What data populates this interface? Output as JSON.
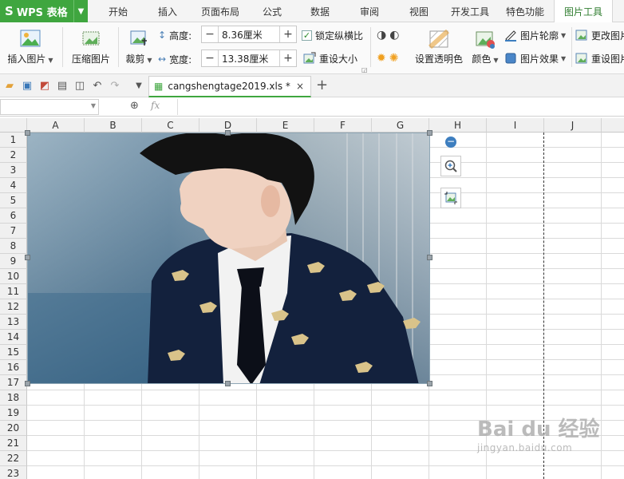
{
  "app": {
    "name": "WPS 表格",
    "logo": "S"
  },
  "menu": {
    "tabs": [
      {
        "label": "开始"
      },
      {
        "label": "插入"
      },
      {
        "label": "页面布局"
      },
      {
        "label": "公式"
      },
      {
        "label": "数据"
      },
      {
        "label": "审阅"
      },
      {
        "label": "视图"
      },
      {
        "label": "开发工具"
      },
      {
        "label": "特色功能"
      },
      {
        "label": "图片工具"
      }
    ],
    "active": "图片工具"
  },
  "ribbon": {
    "insert_picture": "插入图片",
    "compress_picture": "压缩图片",
    "crop": "裁剪",
    "height_label": "高度:",
    "height_value": "8.36厘米",
    "width_label": "宽度:",
    "width_value": "13.38厘米",
    "lock_ratio": "锁定纵横比",
    "lock_ratio_checked": true,
    "reset_size": "重设大小",
    "set_transparent": "设置透明色",
    "color": "颜色",
    "picture_outline": "图片轮廓",
    "picture_effect": "图片效果",
    "change_picture": "更改图片",
    "reset_picture": "重设图片"
  },
  "quick_access": {
    "icons": [
      "open-folder-icon",
      "save-icon",
      "export-pdf-icon",
      "print-icon",
      "print-preview-icon",
      "undo-icon",
      "redo-icon",
      "dropdown-icon"
    ]
  },
  "document_tab": {
    "title": "cangshengtage2019.xls *",
    "add": "+",
    "close": "×"
  },
  "formula_bar": {
    "fx": "fx"
  },
  "sheet": {
    "columns": [
      "A",
      "B",
      "C",
      "D",
      "E",
      "F",
      "G",
      "H",
      "I",
      "J"
    ],
    "rows": [
      "1",
      "2",
      "3",
      "4",
      "5",
      "6",
      "7",
      "8",
      "9",
      "10",
      "11",
      "12",
      "13",
      "14",
      "15",
      "16",
      "17",
      "18",
      "19",
      "20",
      "21",
      "22",
      "23"
    ]
  },
  "watermark": {
    "main": "Bai du 经验",
    "sub": "jingyan.baidu.com"
  },
  "colors": {
    "accent": "#3fa63f",
    "active_tab_text": "#2f7d2f",
    "link_blue": "#3d7ebf"
  }
}
